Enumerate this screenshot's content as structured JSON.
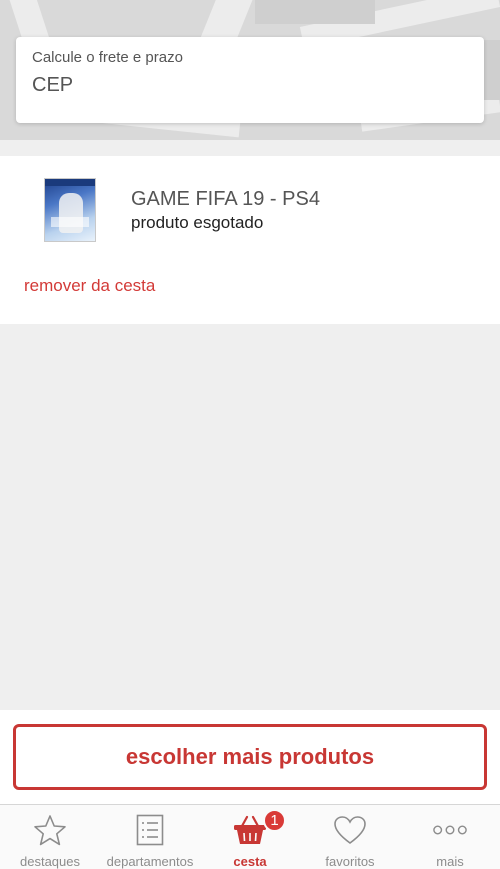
{
  "shipping": {
    "label": "Calcule o frete e prazo",
    "placeholder": "CEP"
  },
  "cart": {
    "items": [
      {
        "name": "GAME FIFA 19 - PS4",
        "status": "produto esgotado",
        "image_icon": "game-cover-image"
      }
    ],
    "remove_label": "remover da cesta"
  },
  "actions": {
    "choose_more_label": "escolher mais produtos"
  },
  "colors": {
    "accent": "#c83734",
    "badge": "#d93a37"
  },
  "tabbar": {
    "tabs": [
      {
        "label": "destaques",
        "icon": "star-icon",
        "active": false
      },
      {
        "label": "departamentos",
        "icon": "list-icon",
        "active": false
      },
      {
        "label": "cesta",
        "icon": "basket-icon",
        "active": true,
        "badge": "1"
      },
      {
        "label": "favoritos",
        "icon": "heart-icon",
        "active": false
      },
      {
        "label": "mais",
        "icon": "more-dots-icon",
        "active": false
      }
    ]
  }
}
